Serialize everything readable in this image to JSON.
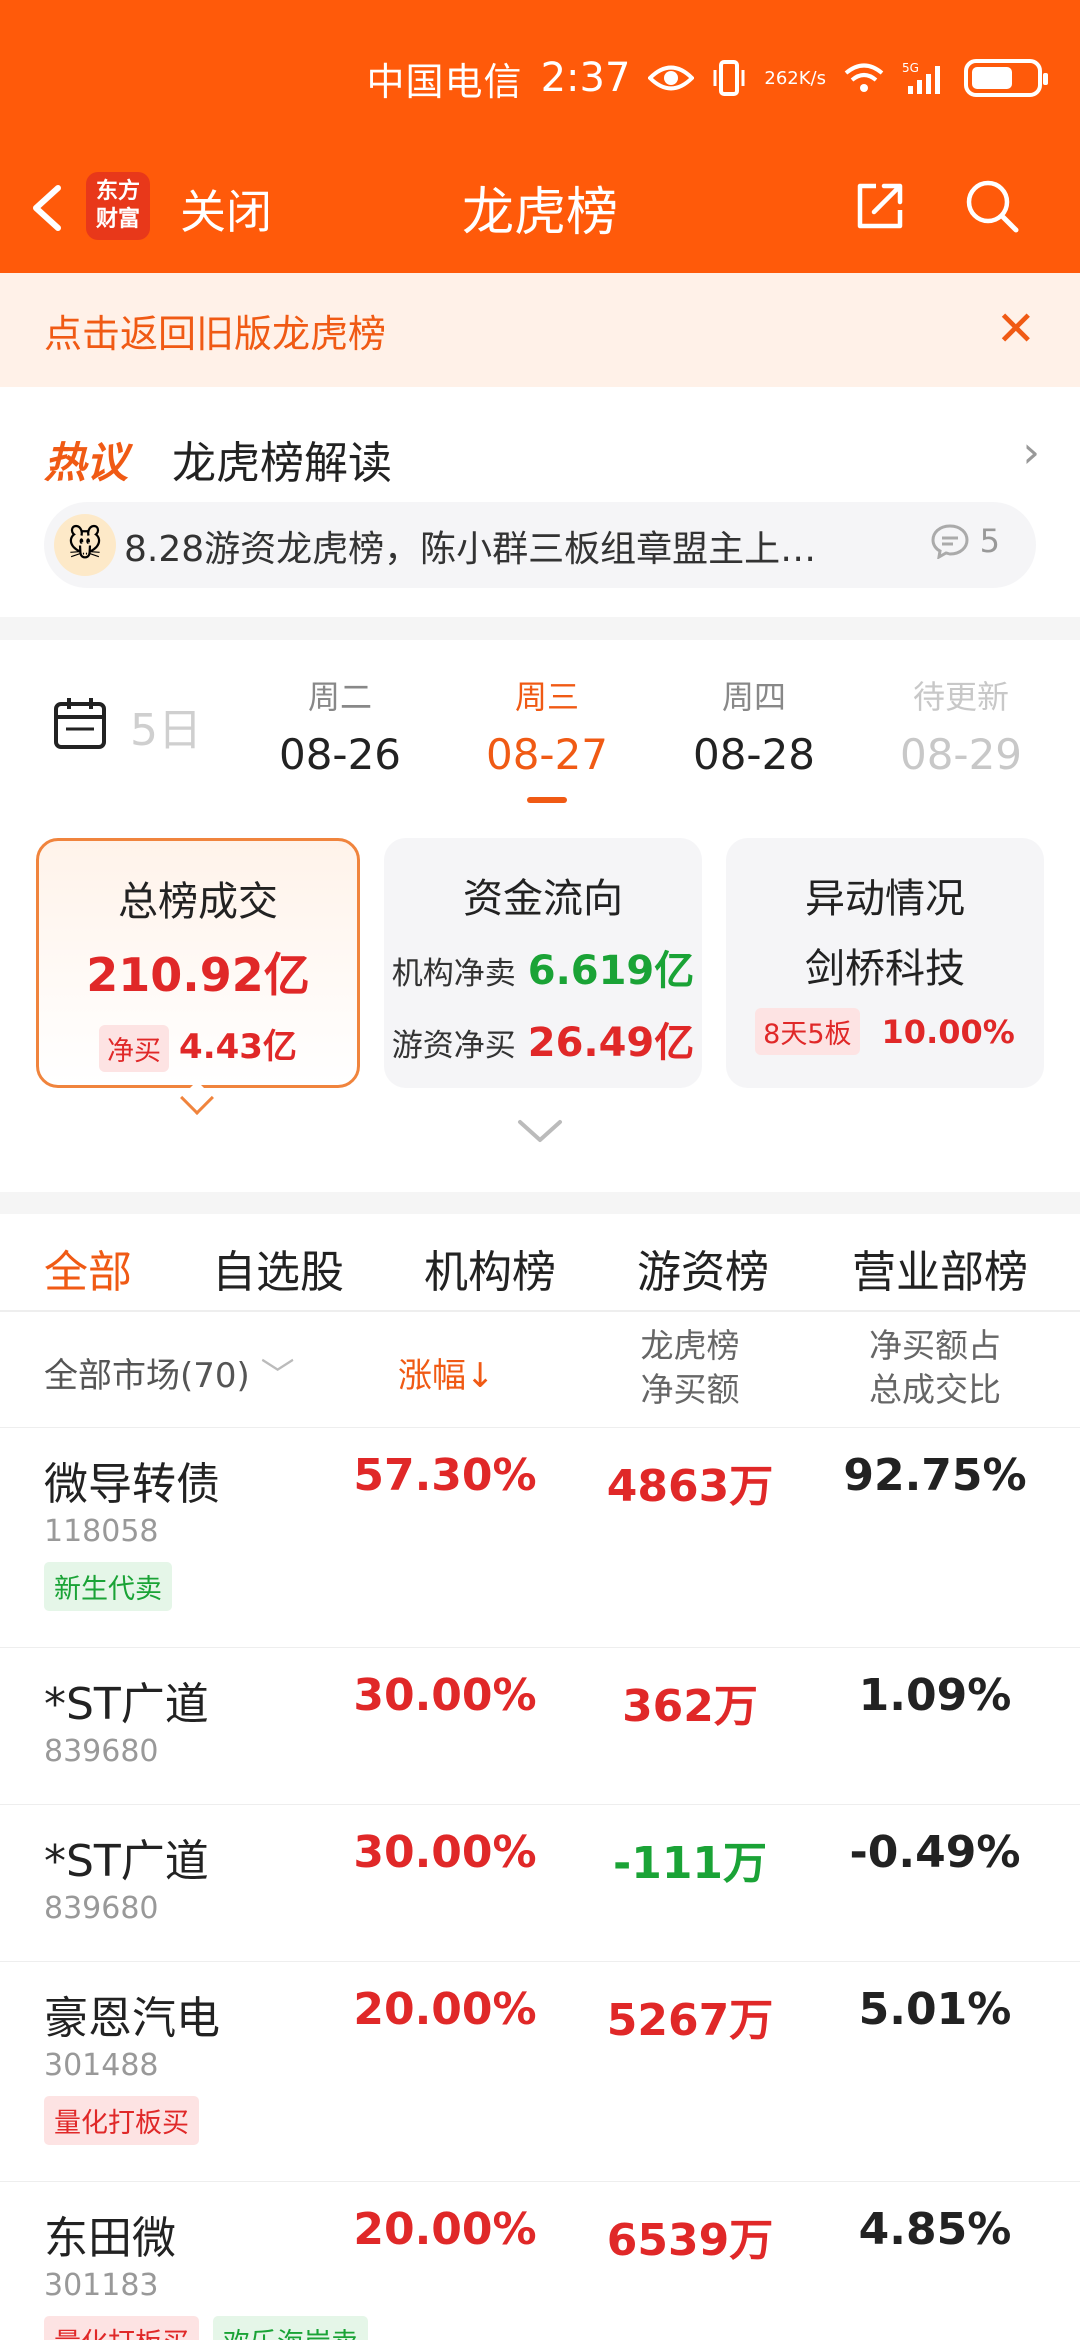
{
  "status_bar": {
    "carrier": "中国电信",
    "time": "2:37",
    "net_speed_top": "262",
    "net_speed_bottom": "K/s",
    "network": "5G"
  },
  "nav": {
    "logo_line1": "东方",
    "logo_line2": "财富",
    "close_label": "关闭",
    "title": "龙虎榜"
  },
  "notice": {
    "text": "点击返回旧版龙虎榜",
    "close": "✕"
  },
  "hot": {
    "badge": "热议",
    "title": "龙虎榜解读",
    "item_text": "8.28游资龙虎榜，陈小群三板组章盟主上…",
    "comment_count": "5"
  },
  "dates": {
    "partial": "5日",
    "days": [
      {
        "week": "周二",
        "date": "08-26"
      },
      {
        "week": "周三",
        "date": "08-27"
      },
      {
        "week": "周四",
        "date": "08-28"
      },
      {
        "week": "待更新",
        "date": "08-29"
      }
    ]
  },
  "summary": {
    "card1": {
      "title": "总榜成交",
      "amount": "210.92亿",
      "tag": "净买",
      "value": "4.43亿"
    },
    "card2": {
      "title": "资金流向",
      "inst_label": "机构净卖",
      "inst_value": "6.619亿",
      "hot_label": "游资净买",
      "hot_value": "26.49亿"
    },
    "card3": {
      "title": "异动情况",
      "stock": "剑桥科技",
      "tag": "8天5板",
      "value": "10.00%"
    }
  },
  "tabs": [
    "全部",
    "自选股",
    "机构榜",
    "游资榜",
    "营业部榜"
  ],
  "table": {
    "market_filter": "全部市场(70)",
    "col_change": "涨幅↓",
    "col_net_line1": "龙虎榜",
    "col_net_line2": "净买额",
    "col_ratio_line1": "净买额占",
    "col_ratio_line2": "总成交比",
    "rows": [
      {
        "name": "微导转债",
        "code": "118058",
        "change": "57.30%",
        "net": "4863万",
        "ratio": "92.75%",
        "tags": [
          {
            "text": "新生代卖",
            "color": "green"
          }
        ]
      },
      {
        "name": "*ST广道",
        "code": "839680",
        "change": "30.00%",
        "net": "362万",
        "ratio": "1.09%",
        "tags": []
      },
      {
        "name": "*ST广道",
        "code": "839680",
        "change": "30.00%",
        "net": "-111万",
        "ratio": "-0.49%",
        "tags": []
      },
      {
        "name": "豪恩汽电",
        "code": "301488",
        "change": "20.00%",
        "net": "5267万",
        "ratio": "5.01%",
        "tags": [
          {
            "text": "量化打板买",
            "color": "red"
          }
        ]
      },
      {
        "name": "东田微",
        "code": "301183",
        "change": "20.00%",
        "net": "6539万",
        "ratio": "4.85%",
        "tags": [
          {
            "text": "量化打板买",
            "color": "red"
          },
          {
            "text": "欢乐海岸卖",
            "color": "green"
          }
        ]
      }
    ]
  },
  "colors": {
    "brand": "#ff5a0a",
    "up": "#e02828",
    "down": "#1aa336"
  }
}
